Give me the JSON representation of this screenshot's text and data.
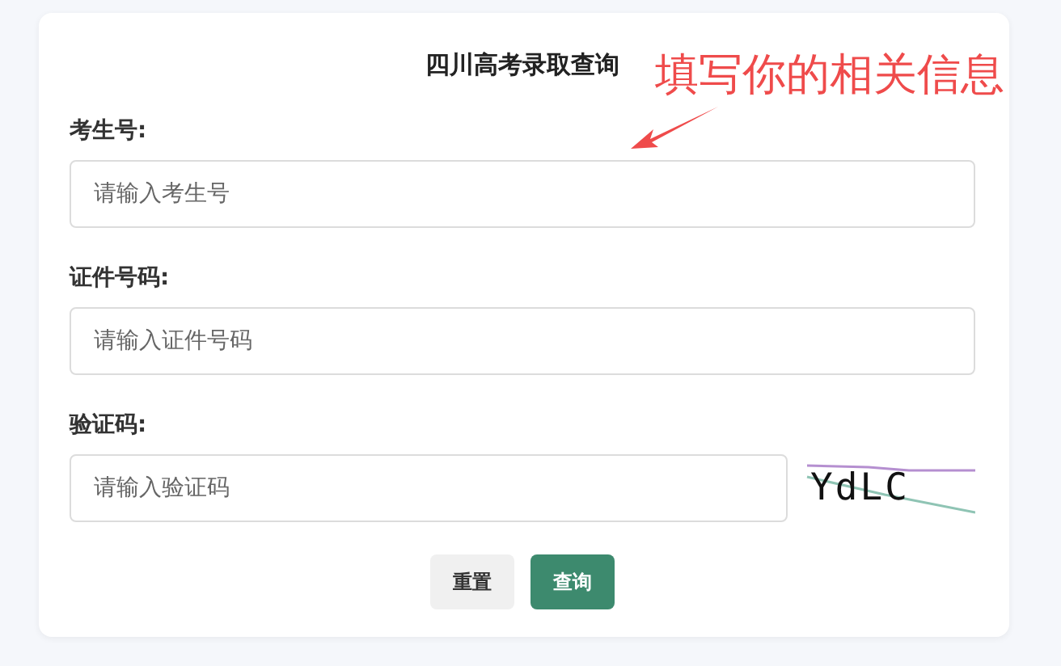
{
  "title": "四川高考录取查询",
  "annotation": {
    "text": "填写你的相关信息"
  },
  "fields": [
    {
      "kind": "text",
      "label": "考生号:",
      "placeholder": "请输入考生号"
    },
    {
      "kind": "text",
      "label": "证件号码:",
      "placeholder": "请输入证件号码"
    },
    {
      "kind": "captcha",
      "label": "验证码:",
      "placeholder": "请输入验证码",
      "captcha": "YdLC"
    }
  ],
  "buttons": [
    {
      "label": "重置",
      "kind": "secondary"
    },
    {
      "label": "查询",
      "kind": "primary"
    }
  ]
}
